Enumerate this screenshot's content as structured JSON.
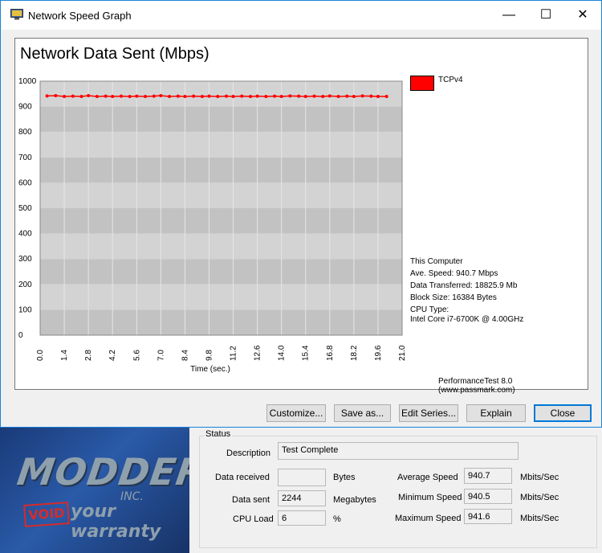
{
  "window": {
    "title": "Network Speed Graph",
    "min_glyph": "—",
    "max_glyph": "☐",
    "close_glyph": "✕"
  },
  "graph": {
    "title": "Network Data Sent (Mbps)",
    "legend_label": "TCPv4",
    "legend_color": "#ff0000",
    "stats": [
      "This Computer",
      "Ave. Speed: 940.7 Mbps",
      "Data Transferred: 18825.9 Mb",
      "Block Size: 16384 Bytes",
      "CPU Type:",
      "Intel Core i7-6700K @ 4.00GHz"
    ],
    "footer": "PerformanceTest 8.0 (www.passmark.com)"
  },
  "chart_data": {
    "type": "line",
    "title": "Network Data Sent (Mbps)",
    "xlabel": "Time (sec.)",
    "ylabel": "",
    "ylim": [
      0,
      1000
    ],
    "xlim": [
      0.0,
      21.0
    ],
    "yticks": [
      "1000",
      "900",
      "800",
      "700",
      "600",
      "500",
      "400",
      "300",
      "200",
      "100",
      "0"
    ],
    "xticks": [
      "0.0",
      "1.4",
      "2.8",
      "4.2",
      "5.6",
      "7.0",
      "8.4",
      "9.8",
      "11.2",
      "12.6",
      "14.0",
      "15.4",
      "16.8",
      "18.2",
      "19.6",
      "21.0"
    ],
    "grid": true,
    "legend_placement": "top-right",
    "series": [
      {
        "name": "TCPv4",
        "color": "#ff0000",
        "x": [
          0.4,
          0.9,
          1.4,
          1.9,
          2.4,
          2.8,
          3.3,
          3.8,
          4.2,
          4.7,
          5.2,
          5.6,
          6.1,
          6.6,
          7.0,
          7.5,
          8.0,
          8.4,
          8.9,
          9.4,
          9.8,
          10.3,
          10.8,
          11.2,
          11.7,
          12.2,
          12.6,
          13.1,
          13.6,
          14.0,
          14.5,
          15.0,
          15.4,
          15.9,
          16.4,
          16.8,
          17.3,
          17.8,
          18.2,
          18.7,
          19.2,
          19.6,
          20.1
        ],
        "y": [
          942,
          943,
          940,
          941,
          940,
          943,
          940,
          941,
          940,
          941,
          940,
          941,
          940,
          941,
          943,
          940,
          941,
          940,
          941,
          940,
          941,
          940,
          941,
          940,
          941,
          940,
          941,
          940,
          941,
          940,
          942,
          941,
          940,
          941,
          940,
          942,
          940,
          941,
          940,
          942,
          941,
          940,
          940
        ]
      }
    ]
  },
  "buttons": {
    "customize": "Customize...",
    "save_as": "Save as...",
    "edit_series": "Edit Series...",
    "explain": "Explain",
    "close": "Close"
  },
  "status": {
    "legend": "Status",
    "description_label": "Description",
    "description_value": "Test Complete",
    "data_received_label": "Data received",
    "data_received_value": "",
    "data_received_unit": "Bytes",
    "data_sent_label": "Data sent",
    "data_sent_value": "2244",
    "data_sent_unit": "Megabytes",
    "cpu_load_label": "CPU Load",
    "cpu_load_value": "6",
    "cpu_load_unit": "%",
    "avg_speed_label": "Average Speed",
    "avg_speed_value": "940.7",
    "min_speed_label": "Minimum Speed",
    "min_speed_value": "940.5",
    "max_speed_label": "Maximum Speed",
    "max_speed_value": "941.6",
    "speed_unit": "Mbits/Sec"
  },
  "background": {
    "logo_main": "MODDERS",
    "logo_sub": "INC.",
    "logo_void": "VOID",
    "logo_tagline": "your warranty"
  }
}
